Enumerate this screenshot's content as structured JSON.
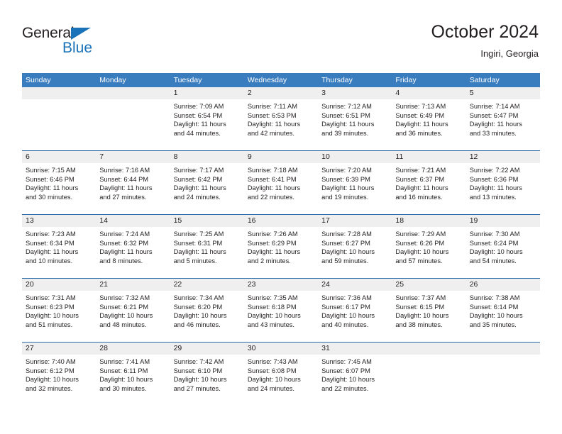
{
  "branding": {
    "logo_primary": "General",
    "logo_secondary": "Blue",
    "logo_icon": "triangle-icon",
    "accent_color": "#1a72b8"
  },
  "header": {
    "title": "October 2024",
    "subtitle": "Ingiri, Georgia"
  },
  "colors": {
    "header_blue": "#3a7dbf",
    "row_divider_blue": "#2b6ca8",
    "date_band_gray": "#efefef",
    "text": "#231f20"
  },
  "day_headers": [
    "Sunday",
    "Monday",
    "Tuesday",
    "Wednesday",
    "Thursday",
    "Friday",
    "Saturday"
  ],
  "weeks": [
    [
      {
        "date": "",
        "lines": [
          "",
          "",
          "",
          ""
        ]
      },
      {
        "date": "",
        "lines": [
          "",
          "",
          "",
          ""
        ]
      },
      {
        "date": "1",
        "lines": [
          "Sunrise: 7:09 AM",
          "Sunset: 6:54 PM",
          "Daylight: 11 hours",
          "and 44 minutes."
        ]
      },
      {
        "date": "2",
        "lines": [
          "Sunrise: 7:11 AM",
          "Sunset: 6:53 PM",
          "Daylight: 11 hours",
          "and 42 minutes."
        ]
      },
      {
        "date": "3",
        "lines": [
          "Sunrise: 7:12 AM",
          "Sunset: 6:51 PM",
          "Daylight: 11 hours",
          "and 39 minutes."
        ]
      },
      {
        "date": "4",
        "lines": [
          "Sunrise: 7:13 AM",
          "Sunset: 6:49 PM",
          "Daylight: 11 hours",
          "and 36 minutes."
        ]
      },
      {
        "date": "5",
        "lines": [
          "Sunrise: 7:14 AM",
          "Sunset: 6:47 PM",
          "Daylight: 11 hours",
          "and 33 minutes."
        ]
      }
    ],
    [
      {
        "date": "6",
        "lines": [
          "Sunrise: 7:15 AM",
          "Sunset: 6:46 PM",
          "Daylight: 11 hours",
          "and 30 minutes."
        ]
      },
      {
        "date": "7",
        "lines": [
          "Sunrise: 7:16 AM",
          "Sunset: 6:44 PM",
          "Daylight: 11 hours",
          "and 27 minutes."
        ]
      },
      {
        "date": "8",
        "lines": [
          "Sunrise: 7:17 AM",
          "Sunset: 6:42 PM",
          "Daylight: 11 hours",
          "and 24 minutes."
        ]
      },
      {
        "date": "9",
        "lines": [
          "Sunrise: 7:18 AM",
          "Sunset: 6:41 PM",
          "Daylight: 11 hours",
          "and 22 minutes."
        ]
      },
      {
        "date": "10",
        "lines": [
          "Sunrise: 7:20 AM",
          "Sunset: 6:39 PM",
          "Daylight: 11 hours",
          "and 19 minutes."
        ]
      },
      {
        "date": "11",
        "lines": [
          "Sunrise: 7:21 AM",
          "Sunset: 6:37 PM",
          "Daylight: 11 hours",
          "and 16 minutes."
        ]
      },
      {
        "date": "12",
        "lines": [
          "Sunrise: 7:22 AM",
          "Sunset: 6:36 PM",
          "Daylight: 11 hours",
          "and 13 minutes."
        ]
      }
    ],
    [
      {
        "date": "13",
        "lines": [
          "Sunrise: 7:23 AM",
          "Sunset: 6:34 PM",
          "Daylight: 11 hours",
          "and 10 minutes."
        ]
      },
      {
        "date": "14",
        "lines": [
          "Sunrise: 7:24 AM",
          "Sunset: 6:32 PM",
          "Daylight: 11 hours",
          "and 8 minutes."
        ]
      },
      {
        "date": "15",
        "lines": [
          "Sunrise: 7:25 AM",
          "Sunset: 6:31 PM",
          "Daylight: 11 hours",
          "and 5 minutes."
        ]
      },
      {
        "date": "16",
        "lines": [
          "Sunrise: 7:26 AM",
          "Sunset: 6:29 PM",
          "Daylight: 11 hours",
          "and 2 minutes."
        ]
      },
      {
        "date": "17",
        "lines": [
          "Sunrise: 7:28 AM",
          "Sunset: 6:27 PM",
          "Daylight: 10 hours",
          "and 59 minutes."
        ]
      },
      {
        "date": "18",
        "lines": [
          "Sunrise: 7:29 AM",
          "Sunset: 6:26 PM",
          "Daylight: 10 hours",
          "and 57 minutes."
        ]
      },
      {
        "date": "19",
        "lines": [
          "Sunrise: 7:30 AM",
          "Sunset: 6:24 PM",
          "Daylight: 10 hours",
          "and 54 minutes."
        ]
      }
    ],
    [
      {
        "date": "20",
        "lines": [
          "Sunrise: 7:31 AM",
          "Sunset: 6:23 PM",
          "Daylight: 10 hours",
          "and 51 minutes."
        ]
      },
      {
        "date": "21",
        "lines": [
          "Sunrise: 7:32 AM",
          "Sunset: 6:21 PM",
          "Daylight: 10 hours",
          "and 48 minutes."
        ]
      },
      {
        "date": "22",
        "lines": [
          "Sunrise: 7:34 AM",
          "Sunset: 6:20 PM",
          "Daylight: 10 hours",
          "and 46 minutes."
        ]
      },
      {
        "date": "23",
        "lines": [
          "Sunrise: 7:35 AM",
          "Sunset: 6:18 PM",
          "Daylight: 10 hours",
          "and 43 minutes."
        ]
      },
      {
        "date": "24",
        "lines": [
          "Sunrise: 7:36 AM",
          "Sunset: 6:17 PM",
          "Daylight: 10 hours",
          "and 40 minutes."
        ]
      },
      {
        "date": "25",
        "lines": [
          "Sunrise: 7:37 AM",
          "Sunset: 6:15 PM",
          "Daylight: 10 hours",
          "and 38 minutes."
        ]
      },
      {
        "date": "26",
        "lines": [
          "Sunrise: 7:38 AM",
          "Sunset: 6:14 PM",
          "Daylight: 10 hours",
          "and 35 minutes."
        ]
      }
    ],
    [
      {
        "date": "27",
        "lines": [
          "Sunrise: 7:40 AM",
          "Sunset: 6:12 PM",
          "Daylight: 10 hours",
          "and 32 minutes."
        ]
      },
      {
        "date": "28",
        "lines": [
          "Sunrise: 7:41 AM",
          "Sunset: 6:11 PM",
          "Daylight: 10 hours",
          "and 30 minutes."
        ]
      },
      {
        "date": "29",
        "lines": [
          "Sunrise: 7:42 AM",
          "Sunset: 6:10 PM",
          "Daylight: 10 hours",
          "and 27 minutes."
        ]
      },
      {
        "date": "30",
        "lines": [
          "Sunrise: 7:43 AM",
          "Sunset: 6:08 PM",
          "Daylight: 10 hours",
          "and 24 minutes."
        ]
      },
      {
        "date": "31",
        "lines": [
          "Sunrise: 7:45 AM",
          "Sunset: 6:07 PM",
          "Daylight: 10 hours",
          "and 22 minutes."
        ]
      },
      {
        "date": "",
        "lines": [
          "",
          "",
          "",
          ""
        ]
      },
      {
        "date": "",
        "lines": [
          "",
          "",
          "",
          ""
        ]
      }
    ]
  ]
}
